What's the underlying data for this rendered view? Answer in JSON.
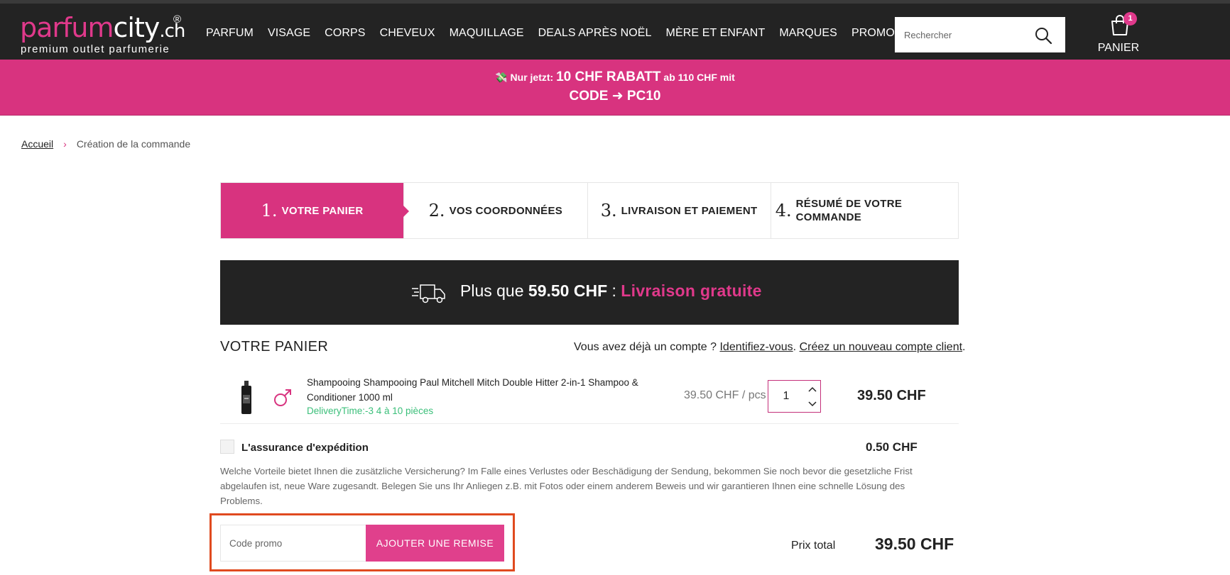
{
  "header": {
    "logo": {
      "part1": "parfum",
      "part2": "city",
      "part3": ".ch",
      "registered": "®",
      "tagline": "premium outlet parfumerie"
    },
    "nav": [
      {
        "label": "PARFUM"
      },
      {
        "label": "VISAGE"
      },
      {
        "label": "CORPS"
      },
      {
        "label": "CHEVEUX"
      },
      {
        "label": "MAQUILLAGE"
      },
      {
        "label": "DEALS APRÈS NOËL"
      },
      {
        "label": "MÈRE ET ENFANT"
      },
      {
        "label": "MARQUES"
      },
      {
        "label": "PROMOS"
      }
    ],
    "search": {
      "placeholder": "Rechercher",
      "icon": "search-icon"
    },
    "cart": {
      "label": "PANIER",
      "count": "1",
      "icon": "shopping-bag-icon"
    }
  },
  "banner": {
    "emoji": "💸",
    "prefix": "Nur jetzt:",
    "highlight": "10 CHF RABATT",
    "suffix": "ab 110 CHF mit",
    "line2": "CODE ➜ PC10",
    "background": "#d8337f"
  },
  "breadcrumb": {
    "home": "Accueil",
    "separator": "›",
    "current": "Création de la commande"
  },
  "steps": [
    {
      "num": "1.",
      "label": "VOTRE PANIER",
      "active": true
    },
    {
      "num": "2.",
      "label": "VOS COORDONNÉES",
      "active": false
    },
    {
      "num": "3.",
      "label": "LIVRAISON ET PAIEMENT",
      "active": false
    },
    {
      "num": "4.",
      "label": "RÉSUMÉ DE VOTRE COMMANDE",
      "active": false
    }
  ],
  "shipping": {
    "prefix": "Plus que",
    "amount": "59.50 CHF",
    "separator": ":",
    "highlight": "Livraison gratuite",
    "icon": "delivery-truck-icon"
  },
  "cart": {
    "title": "VOTRE PANIER",
    "account_prefix": "Vous avez déjà un compte ?",
    "login_link": "Identifiez-vous",
    "dot": ".",
    "register_link": "Créez un nouveau compte client",
    "dot2": ".",
    "items": [
      {
        "name": "Shampooing Shampooing Paul Mitchell Mitch Double Hitter 2-in-1 Shampoo & Conditioner 1000 ml",
        "delivery": "DeliveryTime:-3 4 à 10 pièces",
        "unit_price": "39.50 CHF / pcs",
        "qty": "1",
        "total": "39.50 CHF",
        "gender_icon": "male-symbol-icon"
      }
    ],
    "insurance": {
      "label": "L'assurance d'expédition",
      "price": "0.50 CHF",
      "description": "Welche Vorteile bietet Ihnen die zusätzliche Versicherung? Im Falle eines Verlustes oder Beschädigung der Sendung, bekommen Sie noch bevor die gesetzliche Frist abgelaufen ist, neue Ware zugesandt. Belegen Sie uns Ihr Anliegen z.B. mit Fotos oder einem anderem Beweis und wir garantieren Ihnen eine schnelle Lösung des Problems."
    },
    "promo": {
      "placeholder": "Code promo",
      "button": "AJOUTER UNE REMISE"
    },
    "total_label": "Prix total",
    "total_value": "39.50 CHF"
  },
  "colors": {
    "accent": "#d8337f",
    "dark": "#232323",
    "highlight_border": "#e04a1f",
    "delivery_green": "#3bbf7a"
  }
}
